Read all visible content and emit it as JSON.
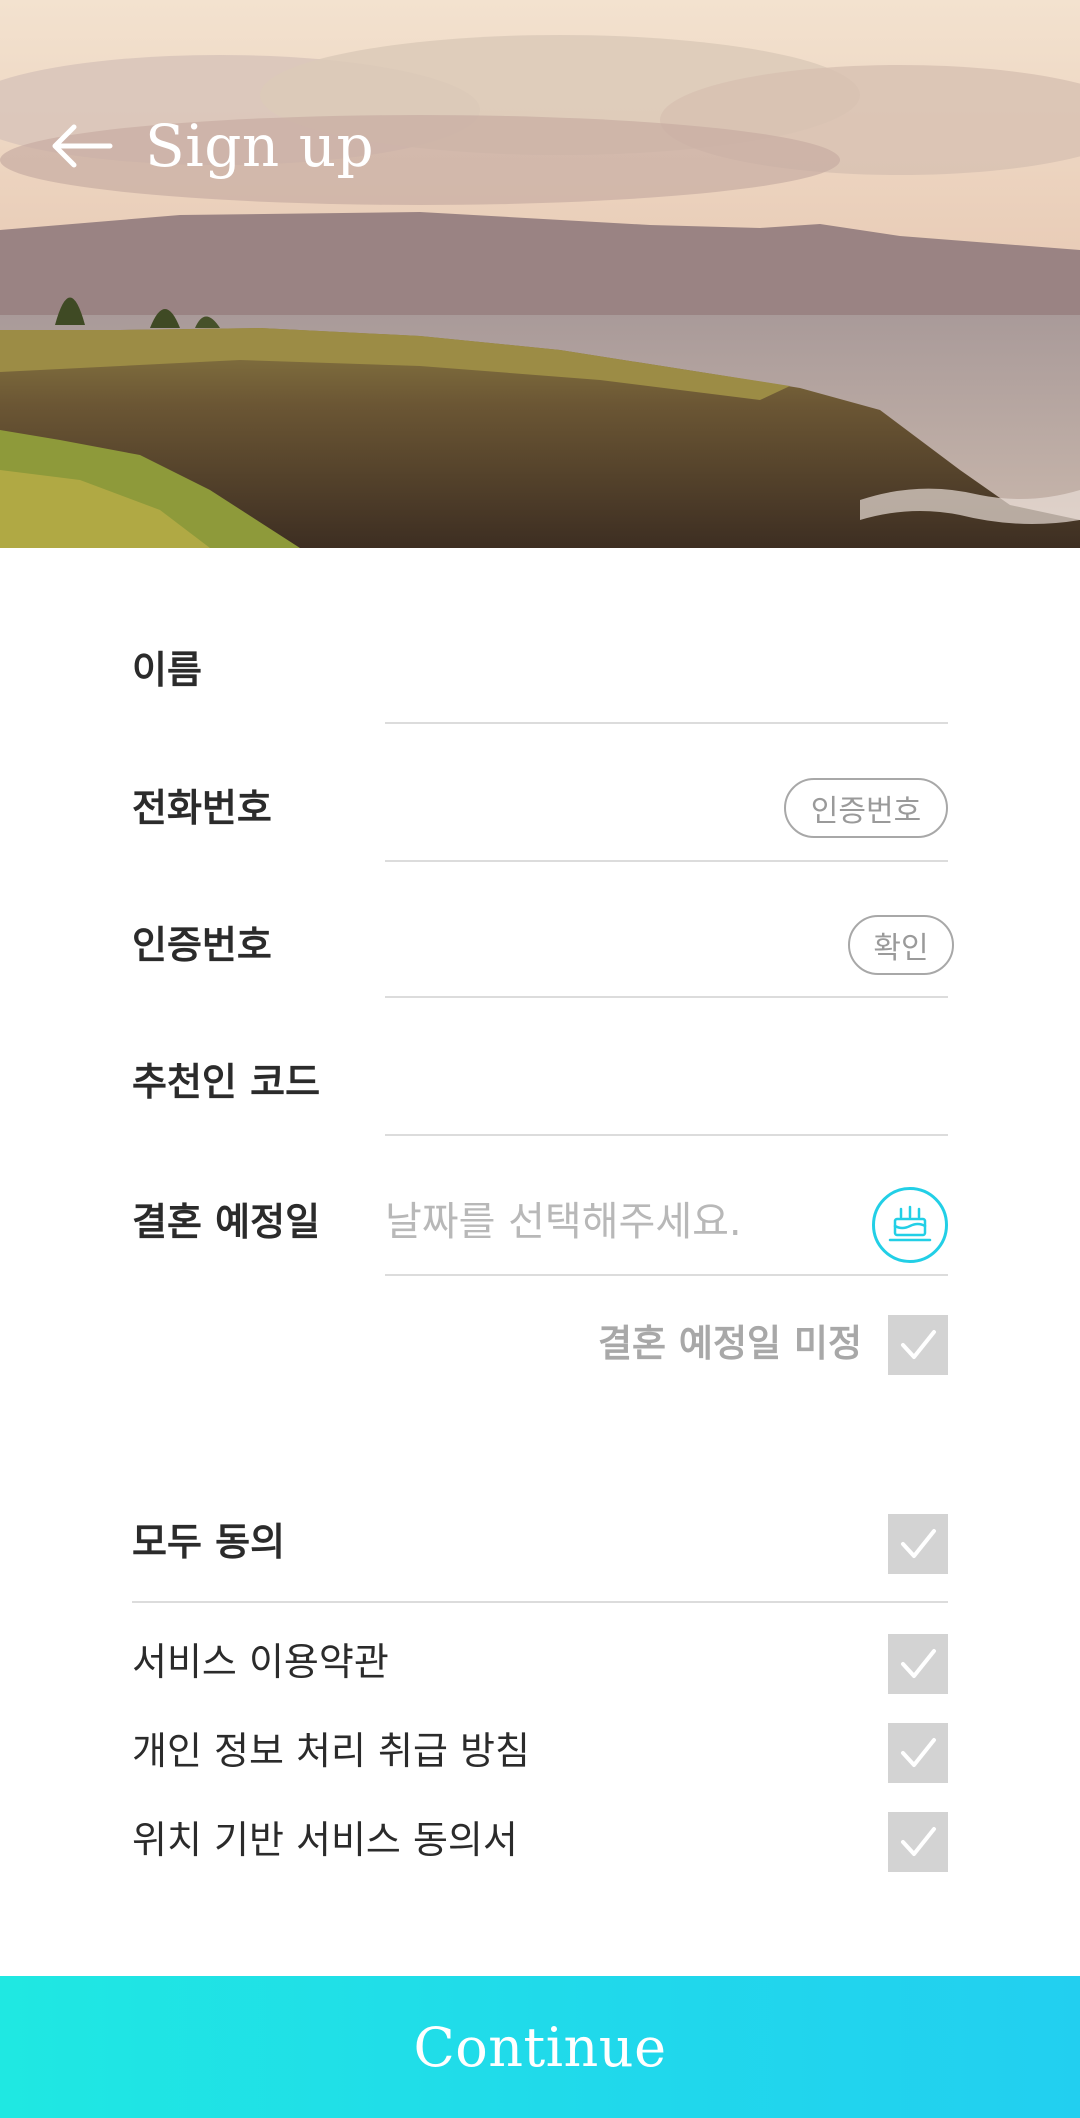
{
  "header": {
    "title": "Sign up",
    "back_icon": "arrow-left-icon"
  },
  "form": {
    "name": {
      "label": "이름",
      "value": ""
    },
    "phone": {
      "label": "전화번호",
      "value": "",
      "button": "인증번호"
    },
    "verify": {
      "label": "인증번호",
      "value": "",
      "button": "확인"
    },
    "referral": {
      "label": "추천인 코드",
      "value": ""
    },
    "wedding": {
      "label": "결혼 예정일",
      "placeholder": "날짜를 선택해주세요.",
      "icon": "cake-icon"
    },
    "undecided": {
      "label": "결혼 예정일 미정",
      "checked": false
    }
  },
  "agreements": {
    "all": {
      "label": "모두 동의",
      "checked": false
    },
    "items": [
      {
        "label": "서비스 이용약관",
        "checked": false
      },
      {
        "label": "개인 정보 처리 취급 방침",
        "checked": false
      },
      {
        "label": "위치 기반 서비스 동의서",
        "checked": false
      }
    ]
  },
  "footer": {
    "continue_label": "Continue"
  },
  "colors": {
    "accent": "#22cfe6",
    "checkbox_bg": "#d3d3d3",
    "button_gradient_start": "#1fe8e2",
    "button_gradient_end": "#22cff0"
  }
}
